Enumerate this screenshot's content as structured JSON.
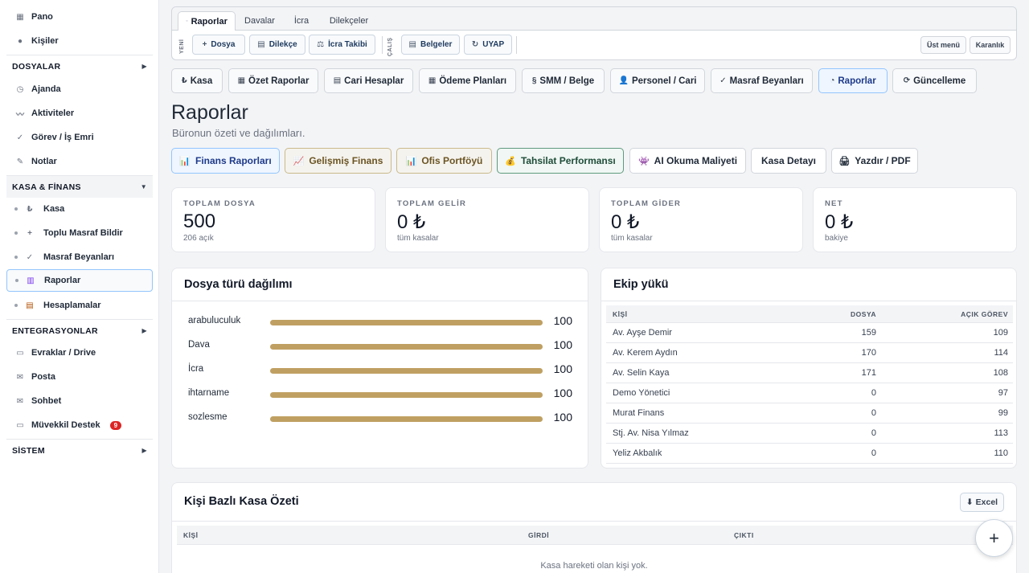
{
  "sidebar": {
    "top_items": [
      {
        "icon": "▦",
        "label": "Pano"
      },
      {
        "icon": "●",
        "label": "Kişiler"
      }
    ],
    "sections": {
      "dosyalar": "DOSYALAR",
      "kasa_finans": "KASA & FİNANS",
      "entegrasyonlar": "ENTEGRASYONLAR",
      "sistem": "SİSTEM"
    },
    "dosyalar_items": [
      {
        "icon": "◷",
        "label": "Ajanda"
      },
      {
        "icon": "〰",
        "label": "Aktiviteler"
      },
      {
        "icon": "✓",
        "label": "Görev / İş Emri"
      },
      {
        "icon": "✎",
        "label": "Notlar"
      }
    ],
    "kasa_items": [
      {
        "icon": "₺",
        "label": "Kasa"
      },
      {
        "icon": "+",
        "label": "Toplu Masraf Bildir"
      },
      {
        "icon": "✓",
        "label": "Masraf Beyanları"
      },
      {
        "icon": "▥",
        "label": "Raporlar"
      },
      {
        "icon": "▤",
        "label": "Hesaplamalar"
      }
    ],
    "entegrasyon_items": [
      {
        "icon": "▭",
        "label": "Evraklar / Drive"
      },
      {
        "icon": "✉",
        "label": "Posta"
      },
      {
        "icon": "✉",
        "label": "Sohbet"
      },
      {
        "icon": "▭",
        "label": "Müvekkil Destek",
        "badge": "9"
      }
    ]
  },
  "toolbar": {
    "tabs": [
      "Raporlar",
      "Davalar",
      "İcra",
      "Dilekçeler"
    ],
    "active_tab_prefix": "◦",
    "yeni_label": "YENİ",
    "calis_label": "ÇALIŞ",
    "new_buttons": [
      {
        "icon": "+",
        "label": "Dosya"
      },
      {
        "icon": "▤",
        "label": "Dilekçe"
      },
      {
        "icon": "⚖",
        "label": "İcra Takibi"
      }
    ],
    "work_buttons": [
      {
        "icon": "▤",
        "label": "Belgeler"
      },
      {
        "icon": "↻",
        "label": "UYAP"
      }
    ],
    "ust_menu": "Üst menü",
    "karanlik": "Karanlık"
  },
  "module_nav": [
    {
      "icon": "₺",
      "label": "Kasa"
    },
    {
      "icon": "▦",
      "label": "Özet Raporlar"
    },
    {
      "icon": "▤",
      "label": "Cari Hesaplar"
    },
    {
      "icon": "▦",
      "label": "Ödeme Planları"
    },
    {
      "icon": "§",
      "label": "SMM / Belge"
    },
    {
      "icon": "👤",
      "label": "Personel / Cari"
    },
    {
      "icon": "✓",
      "label": "Masraf Beyanları"
    },
    {
      "icon": "◔",
      "label": "Raporlar"
    },
    {
      "icon": "⟳",
      "label": "Güncelleme"
    }
  ],
  "page": {
    "title": "Raporlar",
    "subtitle": "Büronun özeti ve dağılımları."
  },
  "report_nav": [
    {
      "icon": "📊",
      "label": "Finans Raporları"
    },
    {
      "icon": "📈",
      "label": "Gelişmiş Finans"
    },
    {
      "icon": "📊",
      "label": "Ofis Portföyü"
    },
    {
      "icon": "💰",
      "label": "Tahsilat Performansı"
    },
    {
      "icon": "👾",
      "label": "AI Okuma Maliyeti"
    },
    {
      "icon": "",
      "label": "Kasa Detayı"
    },
    {
      "icon": "🖨",
      "label": "Yazdır / PDF"
    }
  ],
  "stats": [
    {
      "label": "TOPLAM DOSYA",
      "value": "500",
      "sub": "206 açık"
    },
    {
      "label": "TOPLAM GELİR",
      "value": "0 ₺",
      "sub": "tüm kasalar"
    },
    {
      "label": "TOPLAM GİDER",
      "value": "0 ₺",
      "sub": "tüm kasalar"
    },
    {
      "label": "NET",
      "value": "0 ₺",
      "sub": "bakiye"
    }
  ],
  "distribution": {
    "title": "Dosya türü dağılımı",
    "max": 100,
    "rows": [
      {
        "label": "arabuluculuk",
        "value": 100
      },
      {
        "label": "Dava",
        "value": 100
      },
      {
        "label": "İcra",
        "value": 100
      },
      {
        "label": "ihtarname",
        "value": 100
      },
      {
        "label": "sozlesme",
        "value": 100
      }
    ]
  },
  "team": {
    "title": "Ekip yükü",
    "headers": [
      "KİŞİ",
      "DOSYA",
      "AÇIK GÖREV"
    ],
    "rows": [
      [
        "Av. Ayşe Demir",
        "159",
        "109"
      ],
      [
        "Av. Kerem Aydın",
        "170",
        "114"
      ],
      [
        "Av. Selin Kaya",
        "171",
        "108"
      ],
      [
        "Demo Yönetici",
        "0",
        "97"
      ],
      [
        "Murat Finans",
        "0",
        "99"
      ],
      [
        "Stj. Av. Nisa Yılmaz",
        "0",
        "113"
      ],
      [
        "Yeliz Akbalık",
        "0",
        "110"
      ]
    ]
  },
  "person_cash": {
    "title": "Kişi Bazlı Kasa Özeti",
    "excel": "⬇ Excel",
    "headers": [
      "KİŞİ",
      "GİRDİ",
      "ÇIKTI"
    ],
    "empty": "Kasa hareketi olan kişi yok."
  },
  "fab": "+",
  "colors": {
    "accent_blue": "#93c5fd",
    "bar_fill": "#c0a062",
    "badge_red": "#dc2626"
  }
}
